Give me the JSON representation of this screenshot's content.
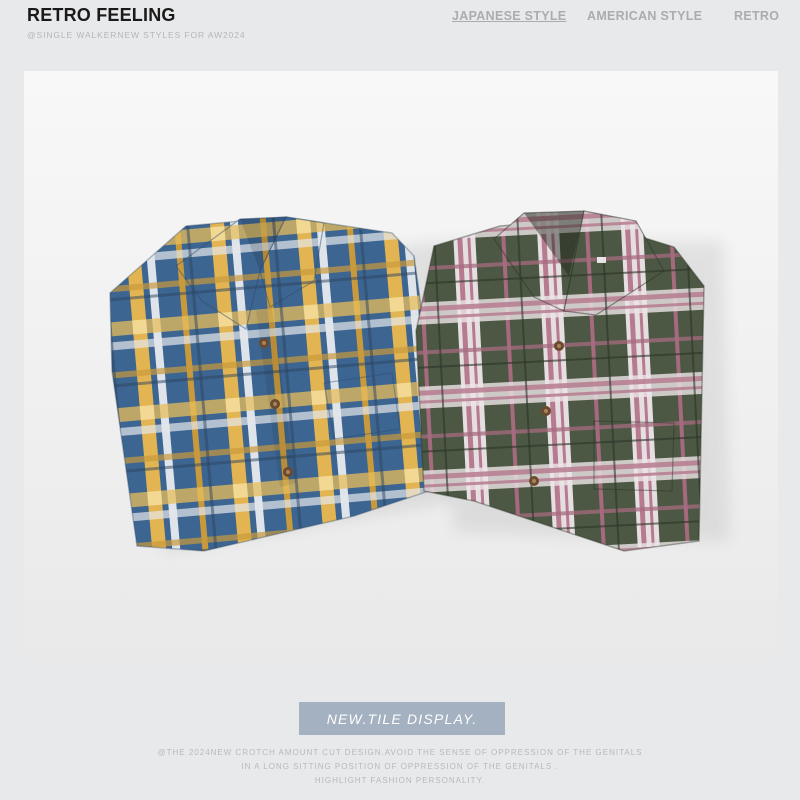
{
  "header": {
    "brand": "RETRO FEELING",
    "tagline": "@SINGLE WALKERNEW STYLES FOR AW2024",
    "nav": [
      {
        "label": "JAPANESE STYLE",
        "active": true
      },
      {
        "label": "AMERICAN STYLE",
        "active": false
      },
      {
        "label": "RETRO",
        "active": false
      }
    ]
  },
  "photo": {
    "subject": "two folded plaid flannel shirts",
    "shirts": [
      {
        "name": "blue-yellow-plaid",
        "colors": [
          "#3f6690",
          "#e0b04f",
          "#dde2e8"
        ]
      },
      {
        "name": "green-pink-plaid",
        "colors": [
          "#4a5640",
          "#b77a8e",
          "#e9e2e4"
        ]
      }
    ]
  },
  "cta": {
    "label": "NEW.TILE DISPLAY."
  },
  "description": [
    "@THE 2024NEW CROTCH AMOUNT CUT DESIGN.AVOID THE SENSE OF OPPRESSION OF THE GENITALS",
    "IN A LONG SITTING POSITION OF OPPRESSION OF THE GENITALS .",
    "HIGHLIGHT FASHION PERSONALITY."
  ],
  "colors": {
    "background": "#e8e9ea",
    "brand_text": "#1a1a1a",
    "muted_text": "#a9adb1",
    "button_bg": "#a3b1c0"
  }
}
